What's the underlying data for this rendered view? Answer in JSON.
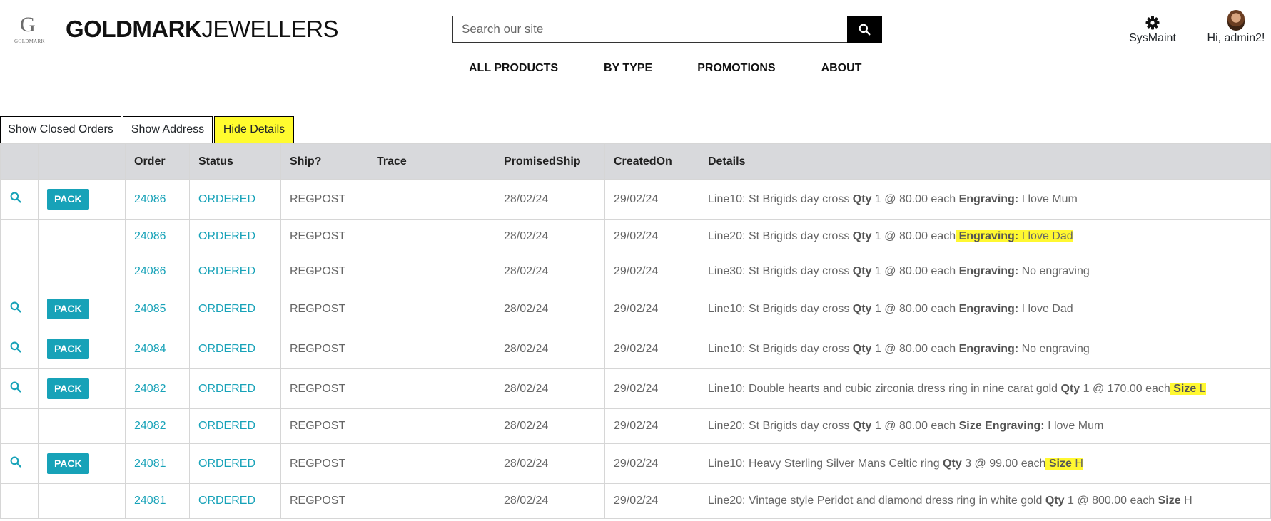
{
  "brand": {
    "logo_letter": "G",
    "logo_sub": "GOLDMARK",
    "name_bold": "GOLDMARK",
    "name_light": "JEWELLERS"
  },
  "search": {
    "placeholder": "Search our site",
    "icon": "search-icon"
  },
  "nav": [
    "ALL PRODUCTS",
    "BY TYPE",
    "PROMOTIONS",
    "ABOUT"
  ],
  "header_right": {
    "sysmaint_label": "SysMaint",
    "sysmaint_icon": "gear-icon",
    "greeting": "Hi, admin2!"
  },
  "toolbar": {
    "closed_orders": "Show Closed Orders",
    "address": "Show Address",
    "details": "Hide Details"
  },
  "columns": [
    "",
    "",
    "Order",
    "Status",
    "Ship?",
    "Trace",
    "PromisedShip",
    "CreatedOn",
    "Details"
  ],
  "pack_label": "PACK",
  "rows": [
    {
      "actions": true,
      "order": "24086",
      "status": "ORDERED",
      "ship": "REGPOST",
      "trace": "",
      "promised": "28/02/24",
      "created": "29/02/24",
      "details": {
        "line": "Line10: St Brigids day cross",
        "qty": "1 @ 80.00 each",
        "extra_label": "Engraving:",
        "extra_value": "I love Mum"
      }
    },
    {
      "actions": false,
      "order": "24086",
      "status": "ORDERED",
      "ship": "REGPOST",
      "trace": "",
      "promised": "28/02/24",
      "created": "29/02/24",
      "details": {
        "line": "Line20: St Brigids day cross",
        "qty": "1 @ 80.00 each",
        "extra_label": "Engraving:",
        "extra_value": "I love Dad"
      }
    },
    {
      "actions": false,
      "order": "24086",
      "status": "ORDERED",
      "ship": "REGPOST",
      "trace": "",
      "promised": "28/02/24",
      "created": "29/02/24",
      "details": {
        "line": "Line30: St Brigids day cross",
        "qty": "1 @ 80.00 each",
        "extra_label": "Engraving:",
        "extra_value": "No engraving"
      }
    },
    {
      "actions": true,
      "order": "24085",
      "status": "ORDERED",
      "ship": "REGPOST",
      "trace": "",
      "promised": "28/02/24",
      "created": "29/02/24",
      "details": {
        "line": "Line10: St Brigids day cross",
        "qty": "1 @ 80.00 each",
        "extra_label": "Engraving:",
        "extra_value": "I love Dad"
      }
    },
    {
      "actions": true,
      "order": "24084",
      "status": "ORDERED",
      "ship": "REGPOST",
      "trace": "",
      "promised": "28/02/24",
      "created": "29/02/24",
      "details": {
        "line": "Line10: St Brigids day cross",
        "qty": "1 @ 80.00 each",
        "extra_label": "Engraving:",
        "extra_value": "No engraving"
      }
    },
    {
      "actions": true,
      "order": "24082",
      "status": "ORDERED",
      "ship": "REGPOST",
      "trace": "",
      "promised": "28/02/24",
      "created": "29/02/24",
      "details": {
        "line": "Line10: Double hearts and cubic zirconia dress ring in nine carat gold",
        "qty": "1 @ 170.00 each",
        "extra_label": "Size",
        "extra_value": "L"
      }
    },
    {
      "actions": false,
      "order": "24082",
      "status": "ORDERED",
      "ship": "REGPOST",
      "trace": "",
      "promised": "28/02/24",
      "created": "29/02/24",
      "details": {
        "line": "Line20: St Brigids day cross",
        "qty": "1 @ 80.00 each",
        "extra_label": "Size Engraving:",
        "extra_value": "I love Mum"
      }
    },
    {
      "actions": true,
      "order": "24081",
      "status": "ORDERED",
      "ship": "REGPOST",
      "trace": "",
      "promised": "28/02/24",
      "created": "29/02/24",
      "details": {
        "line": "Line10: Heavy Sterling Silver Mans Celtic ring",
        "qty": "3 @ 99.00 each",
        "extra_label": "Size",
        "extra_value": "H"
      }
    },
    {
      "actions": false,
      "order": "24081",
      "status": "ORDERED",
      "ship": "REGPOST",
      "trace": "",
      "promised": "28/02/24",
      "created": "29/02/24",
      "details": {
        "line": "Line20: Vintage style Peridot and diamond dress ring in white gold",
        "qty": "1 @ 800.00 each",
        "extra_label": "Size",
        "extra_value": "H"
      }
    }
  ],
  "qty_label": "Qty",
  "colors": {
    "accent": "#17a2b8",
    "header_bg": "#d8d9dc",
    "highlight": "#fff831",
    "search_button": "#000000"
  }
}
